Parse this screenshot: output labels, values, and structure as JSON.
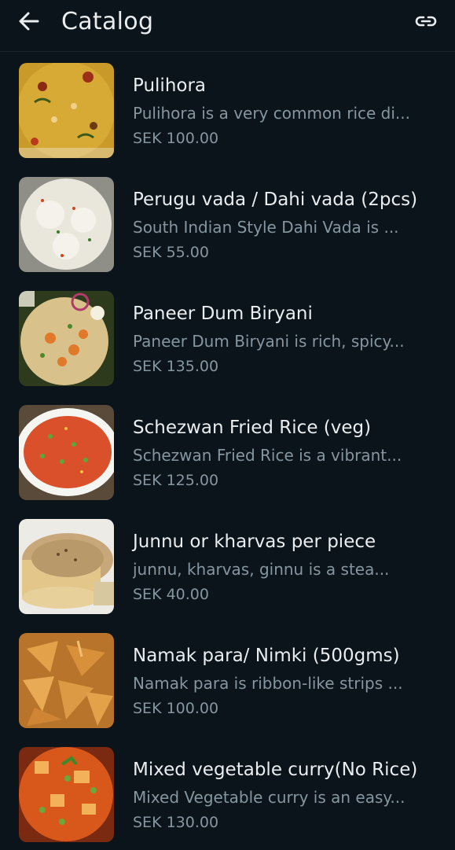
{
  "header": {
    "title": "Catalog",
    "back_icon": "arrow-left-icon",
    "link_icon": "link-icon"
  },
  "items": [
    {
      "name": "Pulihora",
      "desc": "Pulihora is a very common rice di...",
      "price": "SEK 100.00",
      "image": "pulihora-photo"
    },
    {
      "name": "Perugu vada / Dahi vada (2pcs)",
      "desc": "South Indian Style Dahi Vada is ...",
      "price": "SEK 55.00",
      "image": "dahi-vada-photo"
    },
    {
      "name": "Paneer Dum Biryani",
      "desc": "Paneer Dum Biryani is rich, spicy...",
      "price": "SEK 135.00",
      "image": "biryani-photo"
    },
    {
      "name": "Schezwan Fried Rice (veg)",
      "desc": "Schezwan Fried Rice is a vibrant...",
      "price": "SEK 125.00",
      "image": "fried-rice-photo"
    },
    {
      "name": "Junnu or kharvas per piece",
      "desc": "junnu, kharvas, ginnu is a stea...",
      "price": "SEK 40.00",
      "image": "junnu-photo"
    },
    {
      "name": "Namak para/ Nimki (500gms)",
      "desc": "Namak para is ribbon-like strips ...",
      "price": "SEK 100.00",
      "image": "namak-para-photo"
    },
    {
      "name": "Mixed vegetable curry(No Rice)",
      "desc": "Mixed Vegetable curry is an easy...",
      "price": "SEK 130.00",
      "image": "veg-curry-photo"
    }
  ]
}
